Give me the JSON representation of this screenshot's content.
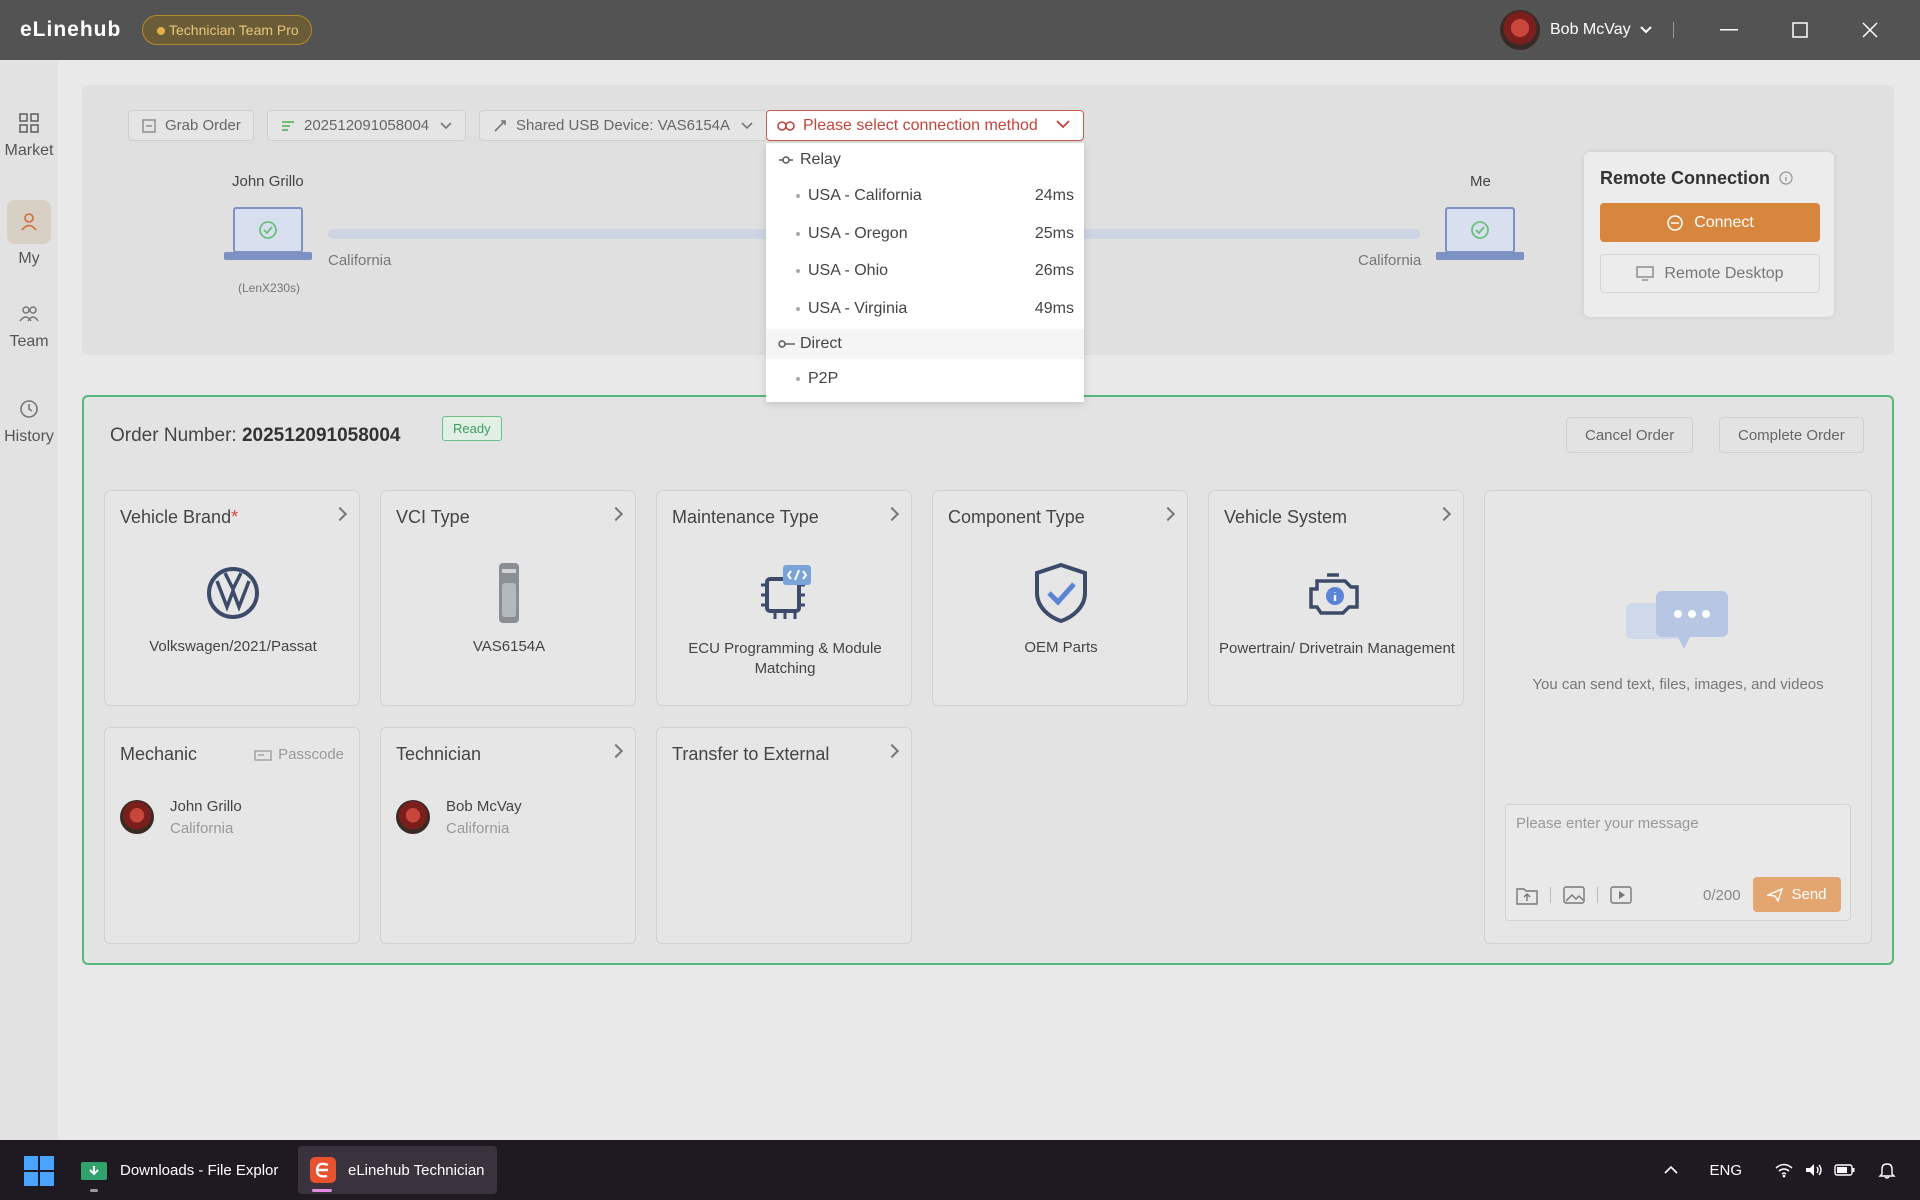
{
  "app": {
    "name": "eLinehub",
    "plan_badge": "Technician Team Pro",
    "user_name": "Bob McVay"
  },
  "sidebar": {
    "items": [
      {
        "label": "Market"
      },
      {
        "label": "My"
      },
      {
        "label": "Team"
      },
      {
        "label": "History"
      }
    ]
  },
  "toolbar": {
    "grab_order": "Grab Order",
    "order_select": "202512091058004",
    "device_select": "Shared USB Device: VAS6154A",
    "connection_placeholder": "Please select connection method"
  },
  "connection_dropdown": {
    "relay_label": "Relay",
    "relay_options": [
      {
        "label": "USA - California",
        "latency": "24ms"
      },
      {
        "label": "USA - Oregon",
        "latency": "25ms"
      },
      {
        "label": "USA - Ohio",
        "latency": "26ms"
      },
      {
        "label": "USA - Virginia",
        "latency": "49ms"
      }
    ],
    "direct_label": "Direct",
    "direct_options": [
      {
        "label": "P2P"
      }
    ]
  },
  "link": {
    "left_name": "John Grillo",
    "left_location": "California",
    "left_device": "(LenX230s)",
    "right_name": "Me",
    "right_location": "California"
  },
  "remote": {
    "title": "Remote Connection",
    "connect_label": "Connect",
    "remote_desktop_label": "Remote Desktop"
  },
  "order": {
    "label": "Order Number:",
    "number": "202512091058004",
    "status": "Ready",
    "cancel_label": "Cancel Order",
    "complete_label": "Complete Order",
    "cards": {
      "vehicle_brand": {
        "title": "Vehicle Brand",
        "required": "*",
        "value": "Volkswagen/2021/Passat"
      },
      "vci_type": {
        "title": "VCI Type",
        "value": "VAS6154A"
      },
      "maintenance_type": {
        "title": "Maintenance Type",
        "value": "ECU Programming & Module Matching"
      },
      "component_type": {
        "title": "Component Type",
        "value": "OEM Parts"
      },
      "vehicle_system": {
        "title": "Vehicle System",
        "value": "Powertrain/ Drivetrain Management"
      },
      "mechanic": {
        "title": "Mechanic",
        "passcode": "Passcode",
        "name": "John Grillo",
        "location": "California"
      },
      "technician": {
        "title": "Technician",
        "name": "Bob McVay",
        "location": "California"
      },
      "transfer": {
        "title": "Transfer to External"
      }
    }
  },
  "chat": {
    "hint": "You can send text, files, images, and videos",
    "placeholder": "Please enter your message",
    "count": "0/200",
    "send_label": "Send"
  },
  "taskbar": {
    "items": [
      {
        "label": "Downloads - File Explor"
      },
      {
        "label": "eLinehub Technician"
      }
    ],
    "lang": "ENG"
  }
}
